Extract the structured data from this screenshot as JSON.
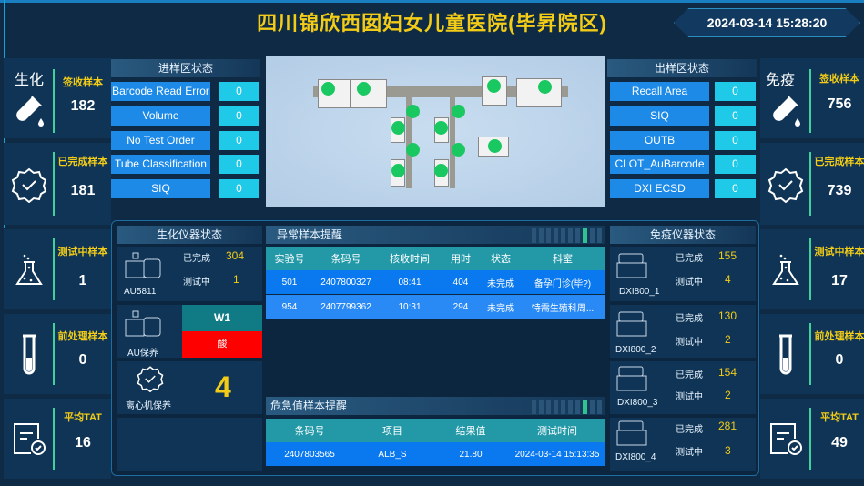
{
  "header": {
    "title": "四川锦欣西囡妇女儿童医院(毕昇院区)",
    "datetime": "2024-03-14 15:28:20"
  },
  "left_cards": {
    "category": "生化",
    "items": [
      {
        "label": "签收样本",
        "value": "182",
        "icon": "test-tube-drop-icon"
      },
      {
        "label": "已完成样本",
        "value": "181",
        "icon": "badge-check-icon"
      },
      {
        "label": "测试中样本",
        "value": "1",
        "icon": "flask-icon"
      },
      {
        "label": "前处理样本",
        "value": "0",
        "icon": "test-tube-icon"
      },
      {
        "label": "平均TAT",
        "value": "16",
        "icon": "report-check-icon"
      }
    ]
  },
  "right_cards": {
    "category": "免疫",
    "items": [
      {
        "label": "签收样本",
        "value": "756",
        "icon": "test-tube-drop-icon"
      },
      {
        "label": "已完成样本",
        "value": "739",
        "icon": "badge-check-icon"
      },
      {
        "label": "测试中样本",
        "value": "17",
        "icon": "flask-icon"
      },
      {
        "label": "前处理样本",
        "value": "0",
        "icon": "test-tube-icon"
      },
      {
        "label": "平均TAT",
        "value": "49",
        "icon": "report-check-icon"
      }
    ]
  },
  "input_zone": {
    "title": "进样区状态",
    "rows": [
      {
        "label": "Barcode Read Error",
        "value": "0"
      },
      {
        "label": "Volume",
        "value": "0"
      },
      {
        "label": "No Test Order",
        "value": "0"
      },
      {
        "label": "Tube Classification",
        "value": "0"
      },
      {
        "label": "SIQ",
        "value": "0"
      }
    ]
  },
  "output_zone": {
    "title": "出样区状态",
    "rows": [
      {
        "label": "Recall Area",
        "value": "0"
      },
      {
        "label": "SIQ",
        "value": "0"
      },
      {
        "label": "OUTB",
        "value": "0"
      },
      {
        "label": "CLOT_AuBarcode",
        "value": "0"
      },
      {
        "label": "DXI ECSD",
        "value": "0"
      }
    ]
  },
  "biochem_instruments": {
    "title": "生化仪器状态",
    "instrument": {
      "name": "AU5811",
      "completed_label": "已完成",
      "completed": "304",
      "testing_label": "测试中",
      "testing": "1"
    },
    "maintenance": {
      "name": "AU保养",
      "w_label": "W1",
      "w_status": "酸"
    },
    "centrifuge": {
      "name": "离心机保养",
      "value": "4"
    }
  },
  "abnormal_samples": {
    "title": "异常样本提醒",
    "columns": [
      "实验号",
      "条码号",
      "核收时间",
      "用时",
      "状态",
      "科室"
    ],
    "rows": [
      [
        "501",
        "2407800327",
        "08:41",
        "404",
        "未完成",
        "备孕门诊(毕?)"
      ],
      [
        "954",
        "2407799362",
        "10:31",
        "294",
        "未完成",
        "特需生殖科周..."
      ]
    ]
  },
  "critical_samples": {
    "title": "危急值样本提醒",
    "columns": [
      "条码号",
      "项目",
      "结果值",
      "测试时间"
    ],
    "rows": [
      [
        "2407803565",
        "ALB_S",
        "21.80",
        "2024-03-14 15:13:35"
      ]
    ]
  },
  "immuno_instruments": {
    "title": "免疫仪器状态",
    "items": [
      {
        "name": "DXI800_1",
        "completed_label": "已完成",
        "completed": "155",
        "testing_label": "测试中",
        "testing": "4"
      },
      {
        "name": "DXI800_2",
        "completed_label": "已完成",
        "completed": "130",
        "testing_label": "测试中",
        "testing": "2"
      },
      {
        "name": "DXI800_3",
        "completed_label": "已完成",
        "completed": "154",
        "testing_label": "测试中",
        "testing": "2"
      },
      {
        "name": "DXI800_4",
        "completed_label": "已完成",
        "completed": "281",
        "testing_label": "测试中",
        "testing": "3"
      }
    ]
  },
  "colors": {
    "accent_yellow": "#f2cc16",
    "ok_green": "#1ac861",
    "alert_red": "#ff0000",
    "label_blue": "#1d8ae8",
    "value_cyan": "#1fc9e8",
    "table_head": "#2399a8"
  }
}
